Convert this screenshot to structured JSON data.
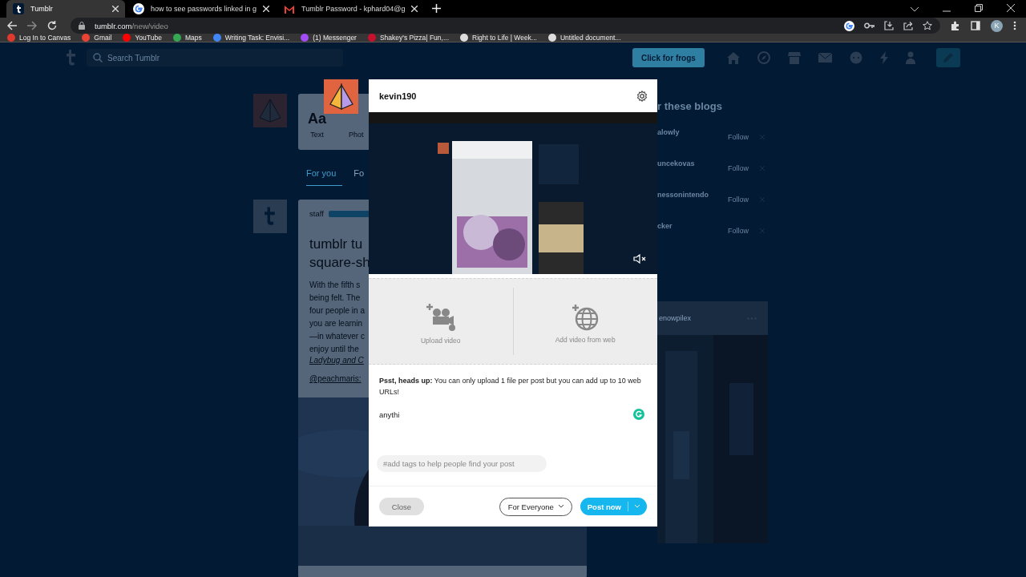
{
  "browser": {
    "tabs": [
      {
        "title": "Tumblr",
        "selected": true
      },
      {
        "title": "how to see passwords linked in g",
        "selected": false
      },
      {
        "title": "Tumblr Password - kphard04@g",
        "selected": false
      }
    ],
    "address": {
      "host": "tumblr.com",
      "path": "/new/video"
    },
    "profile_initial": "K",
    "bookmarks": [
      {
        "label": "Log In to Canvas",
        "color": "#e03a2f"
      },
      {
        "label": "Gmail",
        "color": "#ea4335"
      },
      {
        "label": "YouTube",
        "color": "#ff0000"
      },
      {
        "label": "Maps",
        "color": "#34a853"
      },
      {
        "label": "Writing Task: Envisi...",
        "color": "#4285f4"
      },
      {
        "label": "(1) Messenger",
        "color": "#a34cf5"
      },
      {
        "label": "Shakey's Pizza| Fun,...",
        "color": "#c8102e"
      },
      {
        "label": "Right to Life | Week...",
        "color": "#dddddd"
      },
      {
        "label": "Untitled document...",
        "color": "#dddddd"
      }
    ]
  },
  "dashboard": {
    "search_placeholder": "Search Tumblr",
    "frogs_button": "Click for frogs",
    "composer": [
      {
        "glyph": "Aa",
        "label": "Text"
      },
      {
        "label": "Phot"
      }
    ],
    "feed_tabs": [
      {
        "label": "For you",
        "selected": true
      },
      {
        "label": "Fo",
        "selected": false
      }
    ],
    "post": {
      "blog": "staff",
      "title_lines": [
        "tumblr tu",
        "square-sh"
      ],
      "body_lines": [
        "With the fifth s",
        "being felt. The",
        "four people in a",
        "you are learnin",
        "—in whatever c",
        "enjoy until the"
      ],
      "link_line": "Ladybug and C",
      "mention": "@peachmaris:"
    },
    "sidebar": {
      "heading": "r these blogs",
      "blogs": [
        {
          "name": "alowly",
          "follow": "Follow"
        },
        {
          "name": "uncekovas",
          "follow": "Follow"
        },
        {
          "name": "nessonintendo",
          "follow": "Follow"
        },
        {
          "name": "cker",
          "follow": "Follow"
        }
      ],
      "radar_blog": "enowpilex"
    }
  },
  "modal": {
    "blog": "kevin190",
    "video": {
      "kind": "picture",
      "muted": true
    },
    "sources": [
      {
        "kind": "upload",
        "label": "Upload video"
      },
      {
        "kind": "web",
        "label": "Add video from web"
      }
    ],
    "notice": "**Psst, heads up:**  You can only upload 1 file per post but you can add up to 10 web URLs!",
    "caption_value": "anythi",
    "tags_placeholder": "#add tags to help people find your post",
    "close": "Close",
    "audience": "For Everyone",
    "post": "Post now"
  }
}
